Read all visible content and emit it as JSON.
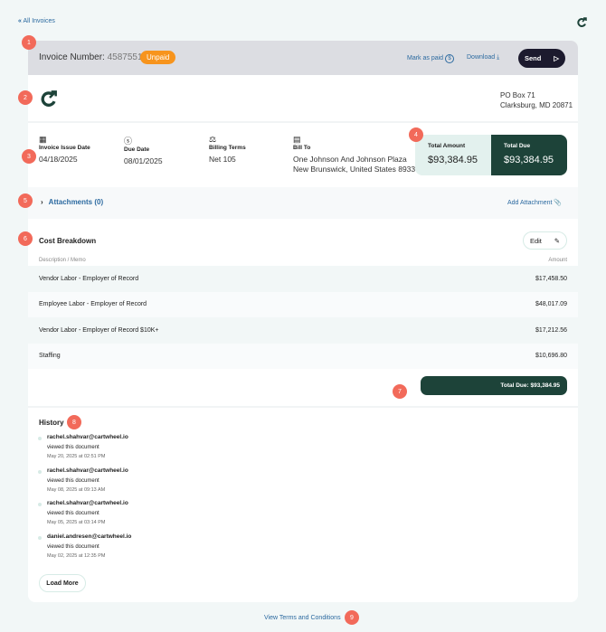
{
  "nav": {
    "back_label": "All Invoices"
  },
  "header": {
    "invoice_label": "Invoice Number:",
    "invoice_number": "4587551",
    "status": "Unpaid",
    "mark_paid": "Mark as paid",
    "download": "Download",
    "send": "Send"
  },
  "company": {
    "address_line1": "PO Box 71",
    "address_line2": "Clarksburg, MD 20871"
  },
  "details": {
    "issue_date_label": "Invoice Issue Date",
    "issue_date": "04/18/2025",
    "due_date_label": "Due Date",
    "due_date": "08/01/2025",
    "terms_label": "Billing Terms",
    "terms": "Net 105",
    "bill_to_label": "Bill To",
    "bill_to_line1": "One Johnson And Johnson Plaza",
    "bill_to_line2": "New Brunswick, United States 8933"
  },
  "totals": {
    "total_amount_label": "Total Amount",
    "total_amount": "$93,384.95",
    "total_due_label": "Total Due",
    "total_due": "$93,384.95"
  },
  "attachments": {
    "label": "Attachments (0)",
    "add": "Add Attachment"
  },
  "cost": {
    "title": "Cost Breakdown",
    "edit": "Edit",
    "col_desc": "Description / Memo",
    "col_amount": "Amount",
    "rows": [
      {
        "desc": "Vendor Labor - Employer of Record",
        "amount": "$17,458.50"
      },
      {
        "desc": "Employee Labor - Employer of Record",
        "amount": "$48,017.09"
      },
      {
        "desc": "Vendor Labor - Employer of Record $10K+",
        "amount": "$17,212.56"
      },
      {
        "desc": "Staffing",
        "amount": "$10,696.80"
      }
    ],
    "total_due": "Total Due: $93,384.95"
  },
  "history": {
    "title": "History",
    "load_more": "Load More",
    "items": [
      {
        "user": "rachel.shahvar@cartwheel.io",
        "action": "viewed this document",
        "time": "May 20, 2025 at 02:51 PM"
      },
      {
        "user": "rachel.shahvar@cartwheel.io",
        "action": "viewed this document",
        "time": "May 08, 2025 at 09:13 AM"
      },
      {
        "user": "rachel.shahvar@cartwheel.io",
        "action": "viewed this document",
        "time": "May 05, 2025 at 03:14 PM"
      },
      {
        "user": "daniel.andresen@cartwheel.io",
        "action": "viewed this document",
        "time": "May 02, 2025 at 12:35 PM"
      }
    ]
  },
  "footer": {
    "terms": "View Terms and Conditions"
  },
  "badges": [
    "1",
    "2",
    "3",
    "4",
    "5",
    "6",
    "7",
    "8",
    "9"
  ],
  "colors": {
    "brand": "#1d4339",
    "accent_orange": "#f7941d",
    "link": "#2c6aa0",
    "dark_button": "#1c1a2e",
    "badge": "#f26a5a"
  }
}
